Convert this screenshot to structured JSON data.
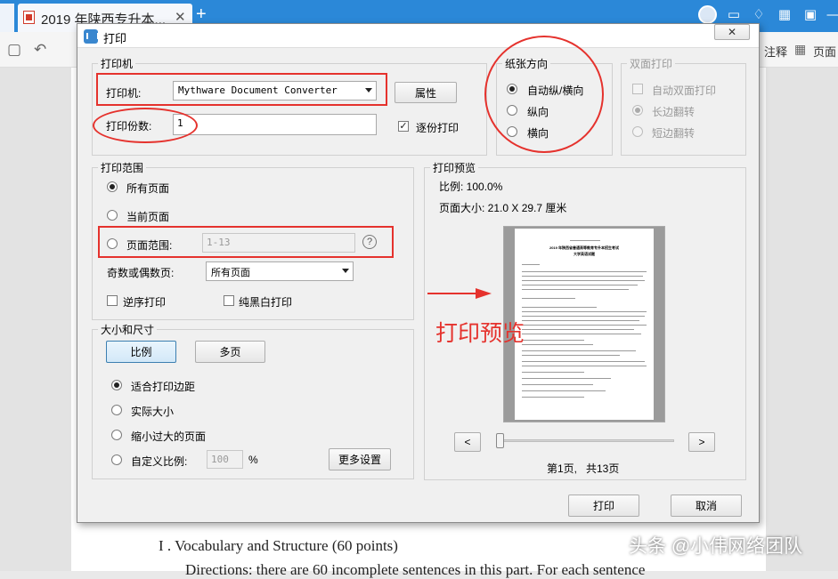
{
  "browser": {
    "tab_title": "2019 年陕西专升本...",
    "tab_close": "✕",
    "new_tab": "+"
  },
  "toolbar": {
    "annotate_label": "注释",
    "page_label": "页面"
  },
  "document": {
    "line1": "I . Vocabulary and Structure (60 points)",
    "line2": "Directions: there are 60 incomplete sentences in this part. For each sentence"
  },
  "dialog": {
    "title": "打印",
    "close_label": "✕",
    "printer_group": {
      "legend": "打印机",
      "printer_label": "打印机:",
      "printer_value": "Mythware Document Converter",
      "properties_button": "属性",
      "copies_label": "打印份数:",
      "copies_value": "1",
      "collate_label": "逐份打印",
      "collate_checked": true
    },
    "orientation_group": {
      "legend": "纸张方向",
      "options": [
        "自动纵/横向",
        "纵向",
        "横向"
      ],
      "selected": 0
    },
    "duplex_group": {
      "legend": "双面打印",
      "auto_duplex_label": "自动双面打印",
      "long_edge_label": "长边翻转",
      "short_edge_label": "短边翻转"
    },
    "range_group": {
      "legend": "打印范围",
      "all_pages": "所有页面",
      "current_page": "当前页面",
      "page_range": "页面范围:",
      "page_range_placeholder": "1-13",
      "help_icon": "?",
      "odd_even_label": "奇数或偶数页:",
      "odd_even_value": "所有页面",
      "reverse_label": "逆序打印",
      "grayscale_label": "纯黑白打印"
    },
    "size_group": {
      "legend": "大小和尺寸",
      "scale_tab": "比例",
      "multi_tab": "多页",
      "options": [
        "适合打印边距",
        "实际大小",
        "缩小过大的页面",
        "自定义比例:"
      ],
      "selected": 0,
      "custom_scale_value": "100",
      "percent": "%",
      "more_settings": "更多设置"
    },
    "preview_group": {
      "legend": "打印预览",
      "scale_text": "比例: 100.0%",
      "page_size_text": "页面大小: 21.0 X 29.7 厘米",
      "prev_button": "<",
      "next_button": ">",
      "page_indicator": "第1页,   共13页",
      "sheet_title": "2019 年陕西省普通高等教育专升本招生考试",
      "sheet_subtitle": "大学英语试题",
      "slider_value": 0
    },
    "print_button": "打印",
    "cancel_button": "取消"
  },
  "annotation": {
    "preview_text": "打印预览",
    "arrow_color": "#e5322d"
  },
  "watermark": {
    "text": "头条 @小伟网络团队"
  },
  "colors": {
    "accent": "#2b88d8",
    "annotation_red": "#e5322d"
  }
}
